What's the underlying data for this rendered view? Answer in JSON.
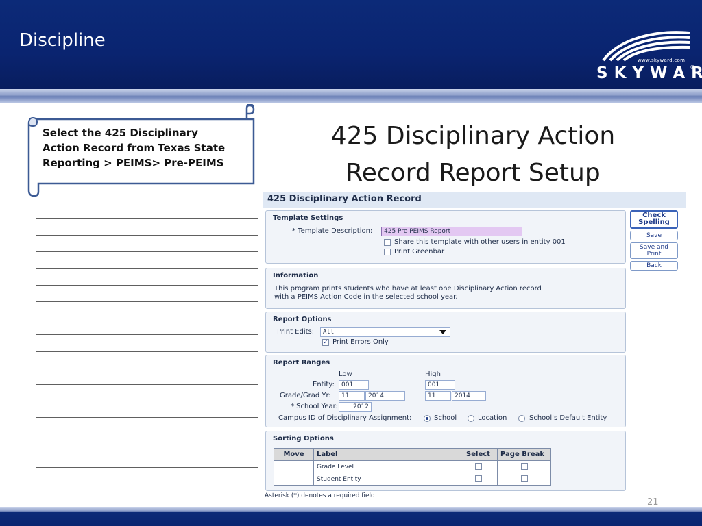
{
  "slide": {
    "title": "Discipline",
    "page_number": "21",
    "colors": {
      "header_navy": "#0c2a78",
      "accent_stripe": "#8b9cc8",
      "highlight_purple": "#e3c8f2"
    }
  },
  "logo": {
    "url": "www.skyward.com",
    "word": "SKYWARD",
    "reg": "®"
  },
  "callout": {
    "lines": [
      "Select the 425 Disciplinary",
      "Action Record from Texas State",
      "Reporting > PEIMS> Pre-PEIMS"
    ]
  },
  "heading": {
    "line1": "425 Disciplinary Action",
    "line2": "Record Report Setup"
  },
  "app": {
    "title": "425 Disciplinary Action Record",
    "template_settings": {
      "title": "Template Settings",
      "desc_label": "* Template Description:",
      "desc_value": "425 Pre PEIMS Report",
      "share_label": "Share this template with other users in entity 001",
      "share_checked": false,
      "greenbar_label": "Print Greenbar",
      "greenbar_checked": false
    },
    "information": {
      "title": "Information",
      "line1": "This program prints students who have at least one Disciplinary Action record",
      "line2": "with a PEIMS Action Code in the selected school year."
    },
    "report_options": {
      "title": "Report Options",
      "print_edits_label": "Print Edits:",
      "print_edits_value": "All",
      "errors_only_label": "Print Errors Only",
      "errors_only_checked": true
    },
    "report_ranges": {
      "title": "Report Ranges",
      "low_header": "Low",
      "high_header": "High",
      "entity_label": "Entity:",
      "entity_low": "001",
      "entity_high": "001",
      "grade_label": "Grade/Grad Yr:",
      "grade_low": "11",
      "grad_yr_low": "2014",
      "grade_high": "11",
      "grad_yr_high": "2014",
      "school_year_label": "* School Year:",
      "school_year_value": "2012",
      "campus_label": "Campus ID of Disciplinary Assignment:",
      "campus_options": [
        "School",
        "Location",
        "School's Default Entity"
      ],
      "campus_selected": "School"
    },
    "sorting": {
      "title": "Sorting Options",
      "columns": [
        "Move",
        "Label",
        "Select",
        "Page Break"
      ],
      "rows": [
        {
          "move": "",
          "label": "Grade Level",
          "select": false,
          "page_break": false
        },
        {
          "move": "",
          "label": "Student Entity",
          "select": false,
          "page_break": false
        }
      ]
    },
    "buttons": {
      "check_spelling_1": "Check",
      "check_spelling_2": "Spelling",
      "save": "Save",
      "save_print_1": "Save and",
      "save_print_2": "Print",
      "back": "Back"
    },
    "footnote": "Asterisk (*) denotes a required field"
  }
}
